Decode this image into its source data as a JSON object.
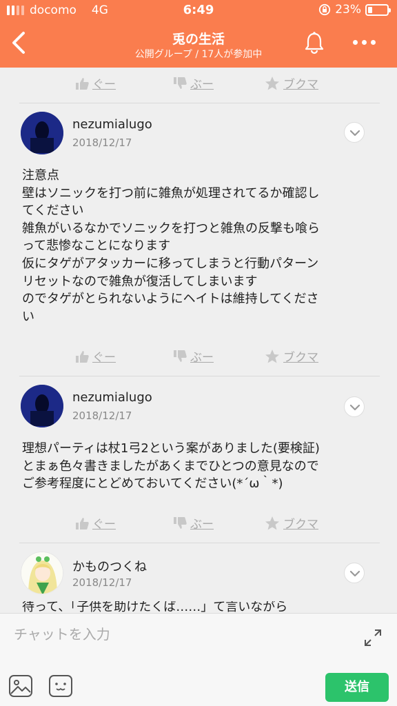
{
  "status_bar": {
    "carrier": "docomo",
    "network": "4G",
    "time": "6:49",
    "battery": "23%",
    "battery_level": 0.23
  },
  "header": {
    "title": "兎の生活",
    "subtitle": "公開グループ / 17人が参加中"
  },
  "actions": {
    "like": "ぐー",
    "dislike": "ぶー",
    "bookmark": "ブクマ"
  },
  "posts": [
    {
      "user": "nezumialugo",
      "date": "2018/12/17",
      "lines": [
        "注意点",
        "壁はソニックを打つ前に雑魚が処理されてるか確認し",
        "てください",
        "雑魚がいるなかでソニックを打つと雑魚の反撃も喰ら",
        "って悲惨なことになります",
        "仮にタゲがアタッカーに移ってしまうと行動パターン",
        "リセットなので雑魚が復活してしまいます",
        "のでタゲがとられないようにヘイトは維持してくださ",
        "い"
      ]
    },
    {
      "user": "nezumialugo",
      "date": "2018/12/17",
      "lines": [
        "理想パーティは杖1弓2という案がありました(要検証)",
        "とまぁ色々書きましたがあくまでひとつの意見なので",
        "ご参考程度にとどめておいてください(*´ω｀*)"
      ]
    },
    {
      "user": "かものつくね",
      "date": "2018/12/17",
      "lines": [
        "待って、「子供を助けたくば……」て言いながら"
      ]
    }
  ],
  "composer": {
    "placeholder": "チャットを入力",
    "send": "送信"
  },
  "colors": {
    "accent": "#fa7d4e",
    "send": "#2cc36b"
  }
}
